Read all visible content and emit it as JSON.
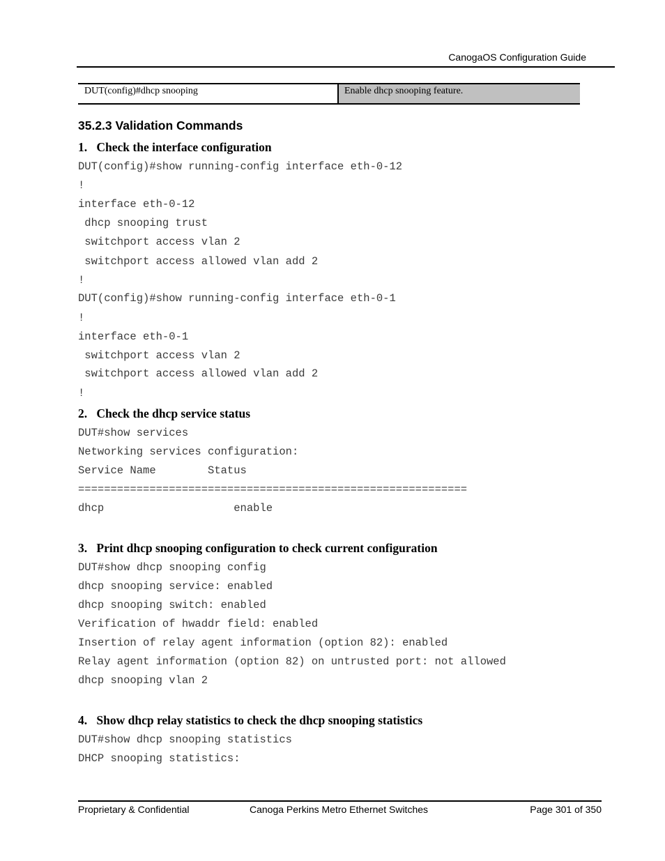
{
  "header": {
    "title": "CanogaOS Configuration Guide"
  },
  "command_table": {
    "rows": [
      {
        "command": "DUT(config)#dhcp snooping",
        "description": "Enable dhcp snooping feature."
      }
    ]
  },
  "section": {
    "title": "35.2.3 Validation Commands"
  },
  "steps": [
    {
      "number": "1.",
      "title": "Check the interface configuration",
      "lines": [
        "DUT(config)#show running-config interface eth-0-12",
        "!",
        "interface eth-0-12",
        " dhcp snooping trust",
        " switchport access vlan 2",
        " switchport access allowed vlan add 2",
        "!",
        "DUT(config)#show running-config interface eth-0-1",
        "!",
        "interface eth-0-1",
        " switchport access vlan 2",
        " switchport access allowed vlan add 2",
        "!"
      ]
    },
    {
      "number": "2.",
      "title": "Check the dhcp service status",
      "lines": [
        "DUT#show services",
        "Networking services configuration:",
        "Service Name        Status",
        "============================================================",
        "dhcp                    enable"
      ]
    },
    {
      "number": "3.",
      "title": "Print dhcp snooping configuration to check current configuration",
      "lines": [
        "DUT#show dhcp snooping config",
        "dhcp snooping service: enabled",
        "dhcp snooping switch: enabled",
        "Verification of hwaddr field: enabled",
        "Insertion of relay agent information (option 82): enabled",
        "Relay agent information (option 82) on untrusted port: not allowed",
        "dhcp snooping vlan 2"
      ]
    },
    {
      "number": "4.",
      "title": "Show dhcp relay statistics to check the dhcp snooping statistics",
      "lines": [
        "DUT#show dhcp snooping statistics",
        "DHCP snooping statistics:"
      ]
    }
  ],
  "footer": {
    "left": "Proprietary & Confidential",
    "center": "Canoga Perkins Metro Ethernet Switches",
    "right": "Page 301 of 350"
  }
}
